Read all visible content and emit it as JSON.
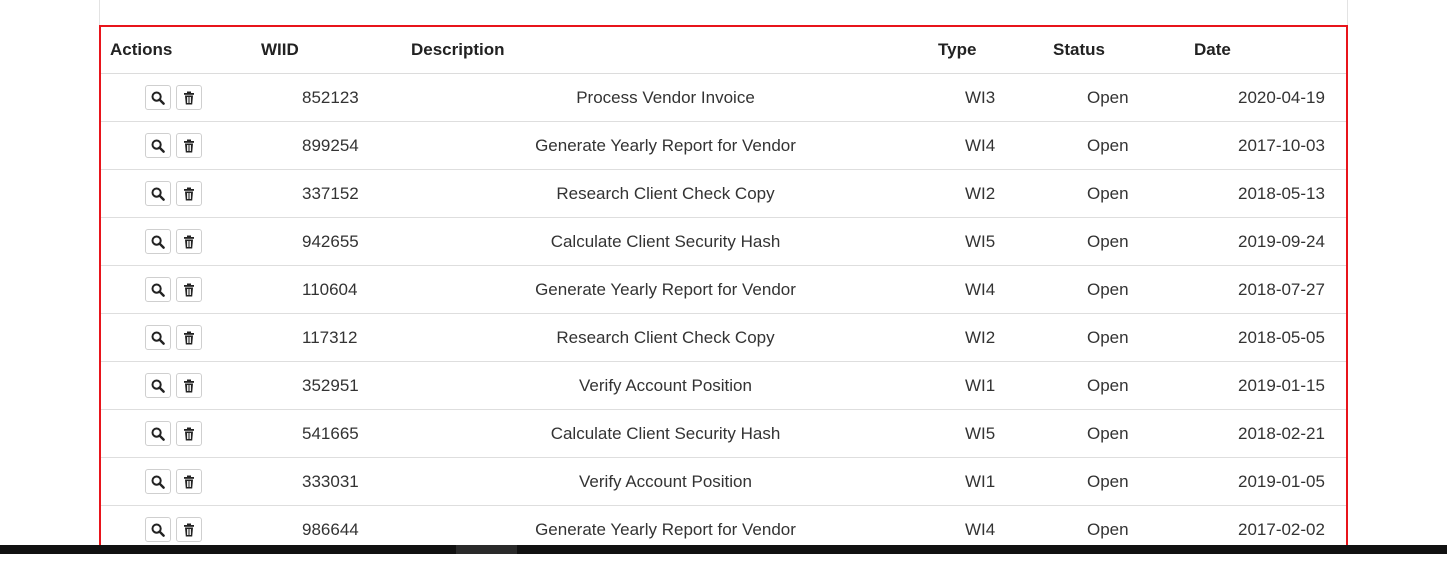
{
  "table": {
    "headers": {
      "actions": "Actions",
      "wiid": "WIID",
      "description": "Description",
      "type": "Type",
      "status": "Status",
      "date": "Date"
    },
    "rows": [
      {
        "wiid": "852123",
        "description": "Process Vendor Invoice",
        "type": "WI3",
        "status": "Open",
        "date": "2020-04-19"
      },
      {
        "wiid": "899254",
        "description": "Generate Yearly Report for Vendor",
        "type": "WI4",
        "status": "Open",
        "date": "2017-10-03"
      },
      {
        "wiid": "337152",
        "description": "Research Client Check Copy",
        "type": "WI2",
        "status": "Open",
        "date": "2018-05-13"
      },
      {
        "wiid": "942655",
        "description": "Calculate Client Security Hash",
        "type": "WI5",
        "status": "Open",
        "date": "2019-09-24"
      },
      {
        "wiid": "110604",
        "description": "Generate Yearly Report for Vendor",
        "type": "WI4",
        "status": "Open",
        "date": "2018-07-27"
      },
      {
        "wiid": "117312",
        "description": "Research Client Check Copy",
        "type": "WI2",
        "status": "Open",
        "date": "2018-05-05"
      },
      {
        "wiid": "352951",
        "description": "Verify Account Position",
        "type": "WI1",
        "status": "Open",
        "date": "2019-01-15"
      },
      {
        "wiid": "541665",
        "description": "Calculate Client Security Hash",
        "type": "WI5",
        "status": "Open",
        "date": "2018-02-21"
      },
      {
        "wiid": "333031",
        "description": "Verify Account Position",
        "type": "WI1",
        "status": "Open",
        "date": "2019-01-05"
      },
      {
        "wiid": "986644",
        "description": "Generate Yearly Report for Vendor",
        "type": "WI4",
        "status": "Open",
        "date": "2017-02-02"
      }
    ],
    "row_actions": {
      "view_icon": "search-icon",
      "delete_icon": "trash-icon"
    }
  },
  "colors": {
    "highlight_border": "#e8141b"
  }
}
